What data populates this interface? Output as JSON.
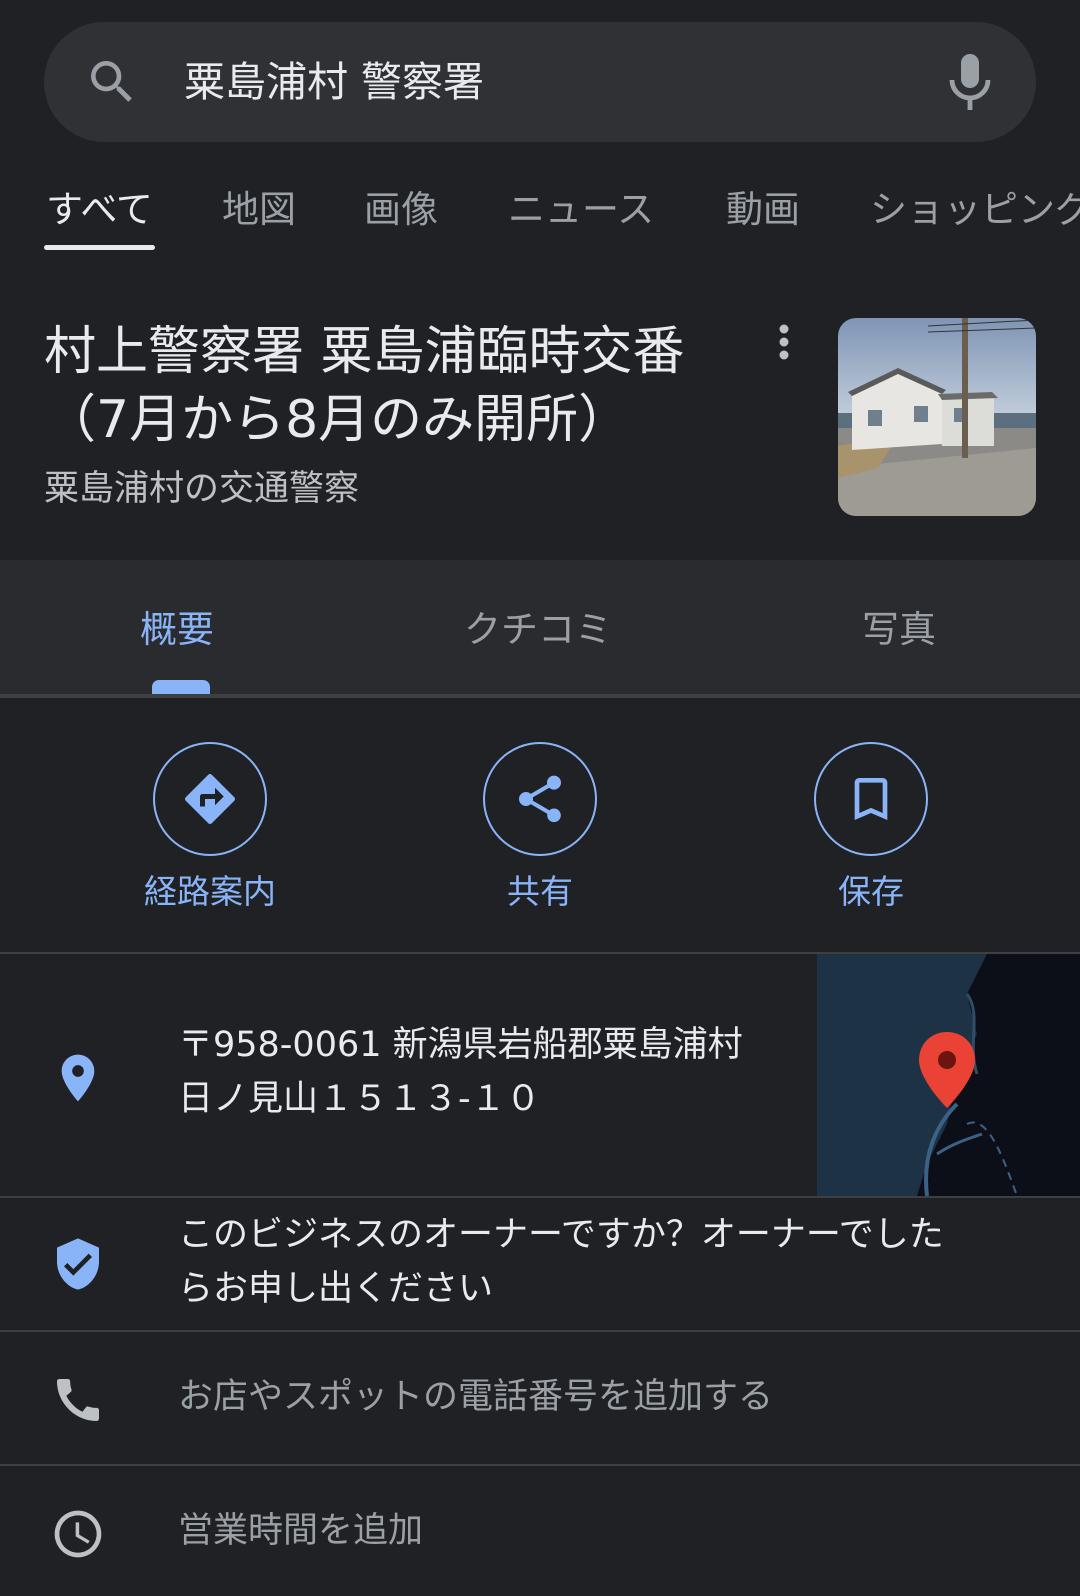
{
  "search": {
    "query": "粟島浦村 警察署"
  },
  "tabs": [
    {
      "label": "すべて",
      "active": true
    },
    {
      "label": "地図"
    },
    {
      "label": "画像"
    },
    {
      "label": "ニュース"
    },
    {
      "label": "動画"
    },
    {
      "label": "ショッピング"
    }
  ],
  "panel": {
    "title": "村上警察署 粟島浦臨時交番（7月から8月のみ開所）",
    "subtitle": "粟島浦村の交通警察"
  },
  "subtabs": [
    {
      "label": "概要",
      "active": true
    },
    {
      "label": "クチコミ"
    },
    {
      "label": "写真"
    }
  ],
  "actions": [
    {
      "label": "経路案内",
      "icon": "directions-icon"
    },
    {
      "label": "共有",
      "icon": "share-icon"
    },
    {
      "label": "保存",
      "icon": "bookmark-icon"
    }
  ],
  "info": {
    "address_line1": "〒958-0061 新潟県岩船郡粟島浦村",
    "address_line2": "日ノ見山１５１３-１０",
    "owner_line1": "このビジネスのオーナーですか？オーナーでした",
    "owner_line2": "らお申し出ください",
    "phone": "お店やスポットの電話番号を追加する",
    "hours": "営業時間を追加"
  },
  "colors": {
    "background": "#202124",
    "accent": "#8ab4f8",
    "map_pin": "#ea4335"
  }
}
